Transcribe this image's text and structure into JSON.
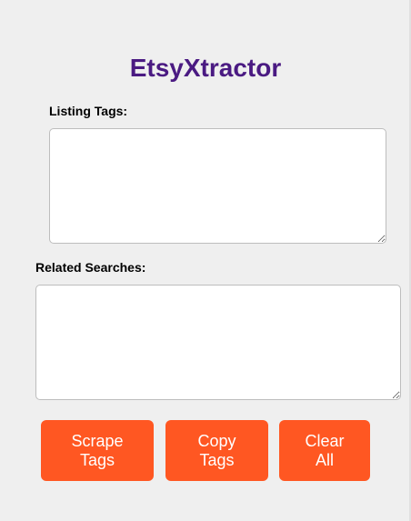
{
  "app": {
    "title": "EtsyXtractor"
  },
  "listing_tags": {
    "label": "Listing Tags:",
    "value": ""
  },
  "related_searches": {
    "label": "Related Searches:",
    "value": ""
  },
  "buttons": {
    "scrape_label": "Scrape\nTags",
    "copy_label": "Copy\nTags",
    "clear_label": "Clear\nAll"
  },
  "colors": {
    "title": "#4a1a82",
    "button": "#ff5722",
    "background": "#efefef"
  }
}
